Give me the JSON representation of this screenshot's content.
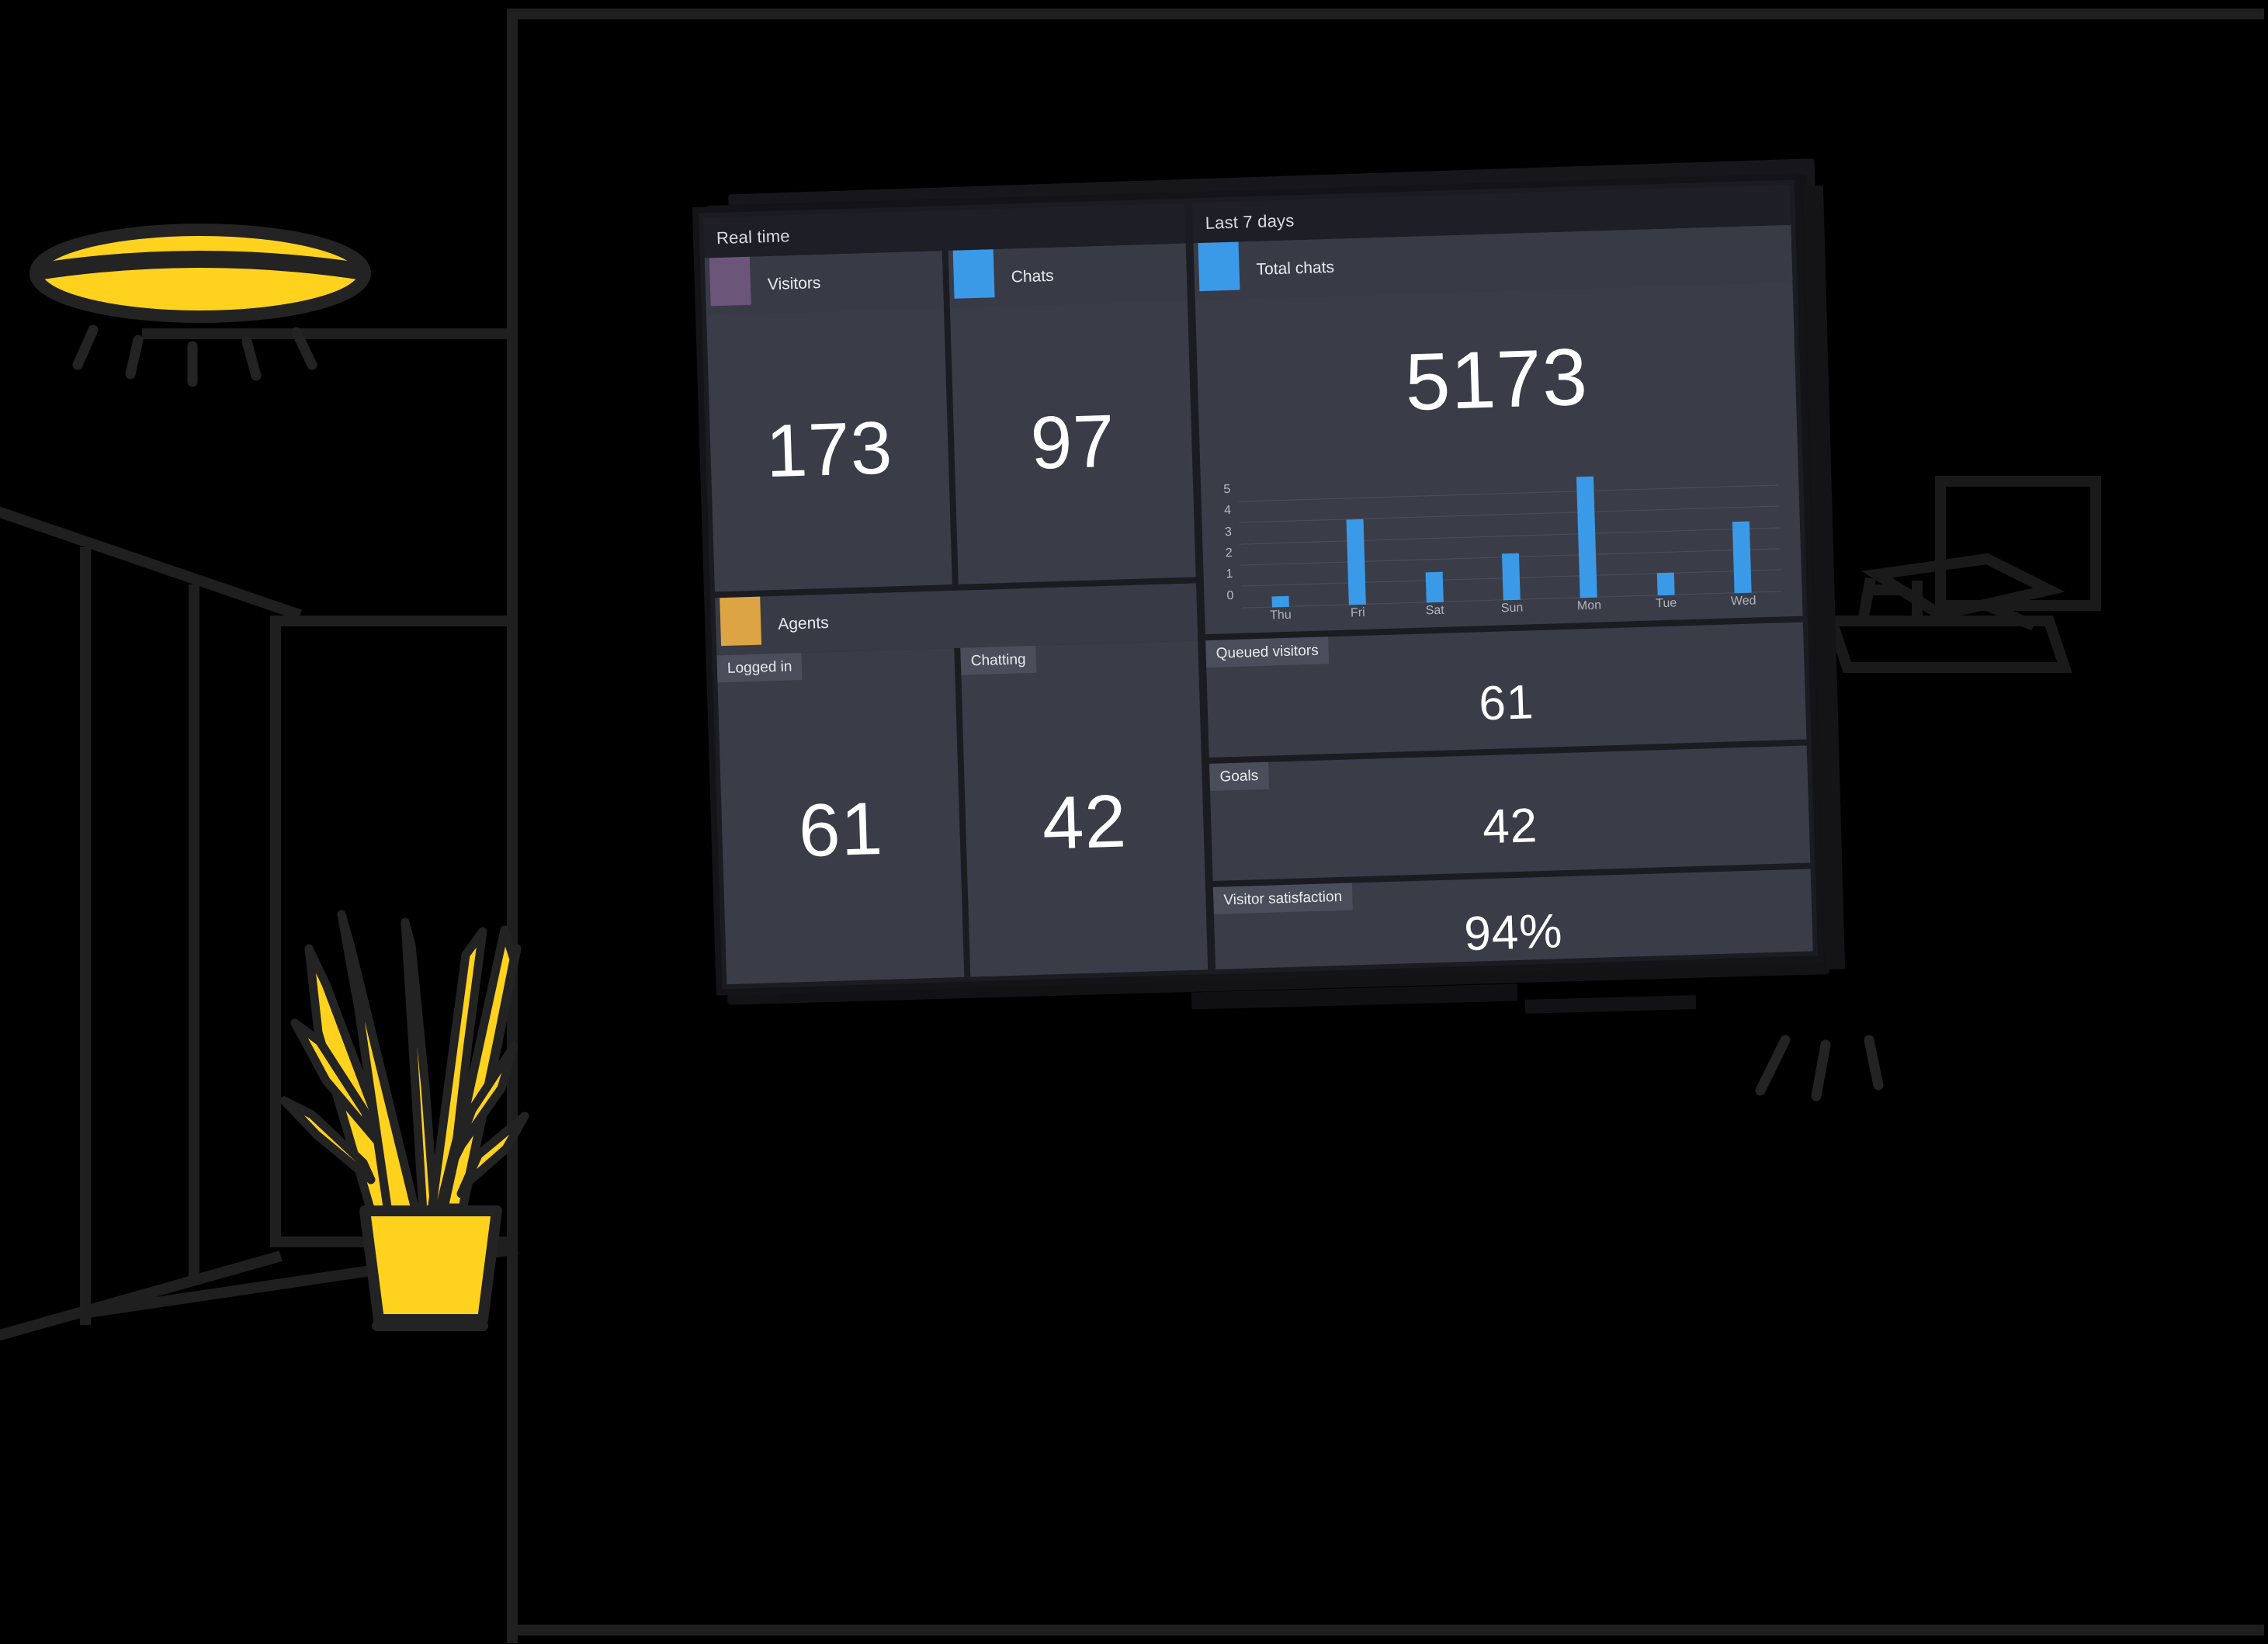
{
  "scene": {
    "description": "Wall-mounted TV showing a live-chat analytics dashboard in a dark line-art office",
    "accent_yellow": "#FFD21E",
    "line_color": "#1f1f1f",
    "background": "#000000",
    "props": [
      {
        "name": "ceiling-lamp",
        "color": "#FFD21E"
      },
      {
        "name": "potted-plant",
        "color": "#FFD21E"
      },
      {
        "name": "doorway-wall",
        "color": "#1f1f1f"
      },
      {
        "name": "desk-monitor",
        "color": "#1a1a1a"
      }
    ]
  },
  "dashboard": {
    "screen_bg": "#1b1c22",
    "panel_bg": "#3a3d48",
    "header_bg": "#1e1f26",
    "tag_bg": "#4a4e5a",
    "left": {
      "section_title": "Real time",
      "tiles": [
        {
          "title": "Visitors",
          "swatch_color": "#6b5579",
          "value": "173"
        },
        {
          "title": "Chats",
          "swatch_color": "#3b9ae8",
          "value": "97"
        }
      ],
      "agents": {
        "title": "Agents",
        "swatch_color": "#dda443",
        "tiles": [
          {
            "tag": "Logged in",
            "value": "61"
          },
          {
            "tag": "Chatting",
            "value": "42"
          }
        ]
      }
    },
    "right": {
      "section_title": "Last 7 days",
      "total_chats": {
        "title": "Total chats",
        "swatch_color": "#3b9ae8",
        "value": "5173"
      },
      "stats": [
        {
          "tag": "Queued visitors",
          "value": "61"
        },
        {
          "tag": "Goals",
          "value": "42"
        },
        {
          "tag": "Visitor satisfaction",
          "value": "94%"
        }
      ]
    }
  },
  "chart_data": {
    "type": "bar",
    "title": "Total chats",
    "xlabel": "",
    "ylabel": "",
    "categories": [
      "Thu",
      "Fri",
      "Sat",
      "Sun",
      "Mon",
      "Tue",
      "Wed"
    ],
    "values": [
      0.5,
      4.0,
      1.4,
      2.2,
      5.7,
      1.05,
      3.35
    ],
    "ylim": [
      0,
      6
    ],
    "yticks": [
      0,
      1,
      2,
      3,
      4,
      5
    ],
    "grid": true,
    "legend": false,
    "series_color": "#3b9ae8"
  }
}
